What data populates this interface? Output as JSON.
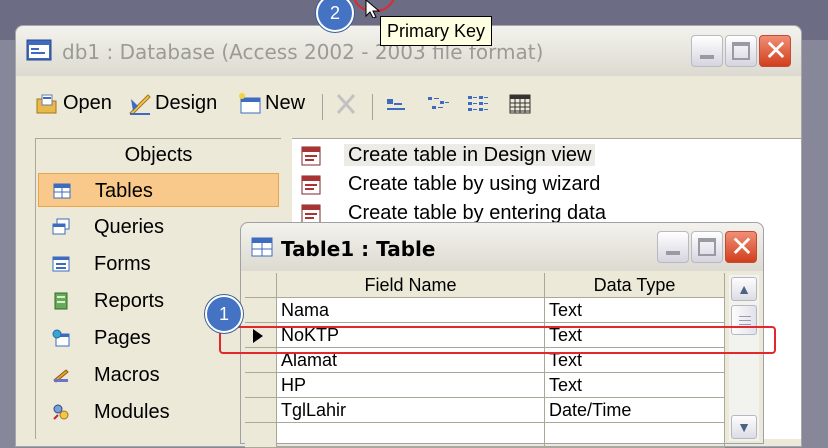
{
  "db_window": {
    "title": "db1 : Database (Access 2002 - 2003 file format)",
    "toolbar": {
      "open": "Open",
      "design": "Design",
      "new": "New"
    },
    "objects_header": "Objects",
    "objects": [
      "Tables",
      "Queries",
      "Forms",
      "Reports",
      "Pages",
      "Macros",
      "Modules"
    ],
    "selected_object": "Tables",
    "list_items": [
      "Create table in Design view",
      "Create table by using wizard",
      "Create table by entering data"
    ]
  },
  "table_window": {
    "title": "Table1 : Table",
    "columns": [
      "Field Name",
      "Data Type"
    ],
    "rows": [
      {
        "field": "Nama",
        "type": "Text"
      },
      {
        "field": "NoKTP",
        "type": "Text"
      },
      {
        "field": "Alamat",
        "type": "Text"
      },
      {
        "field": "HP",
        "type": "Text"
      },
      {
        "field": "TglLahir",
        "type": "Date/Time"
      }
    ]
  },
  "annotations": {
    "badge_1": "1",
    "badge_2": "2",
    "tooltip": "Primary Key"
  },
  "colors": {
    "selection": "#f8c98a",
    "highlight": "#e3272d",
    "badge": "#4473c4"
  }
}
